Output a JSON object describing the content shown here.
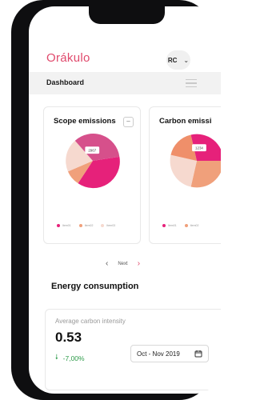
{
  "app": {
    "logo": "Orákulo",
    "user_initials": "RC"
  },
  "header": {
    "title": "Dashboard"
  },
  "cards": [
    {
      "title": "Scope emissions",
      "tooltip": "2967",
      "legend": [
        "Item01",
        "Item02",
        "Item03"
      ]
    },
    {
      "title": "Carbon emissi",
      "tooltip": "1234",
      "legend": [
        "Item01",
        "Item02"
      ]
    }
  ],
  "pagination": {
    "next_label": "Next"
  },
  "energy": {
    "section_title": "Energy consumption",
    "metric_label": "Average carbon intensity",
    "metric_value": "0.53",
    "change": "-7,00%",
    "date_range": "Oct - Nov 2019"
  },
  "colors": {
    "accent": "#e0496c",
    "pink": "#e6217a",
    "salmon": "#f0a07b",
    "light": "#f6d9cf",
    "green": "#2e9c4a"
  }
}
